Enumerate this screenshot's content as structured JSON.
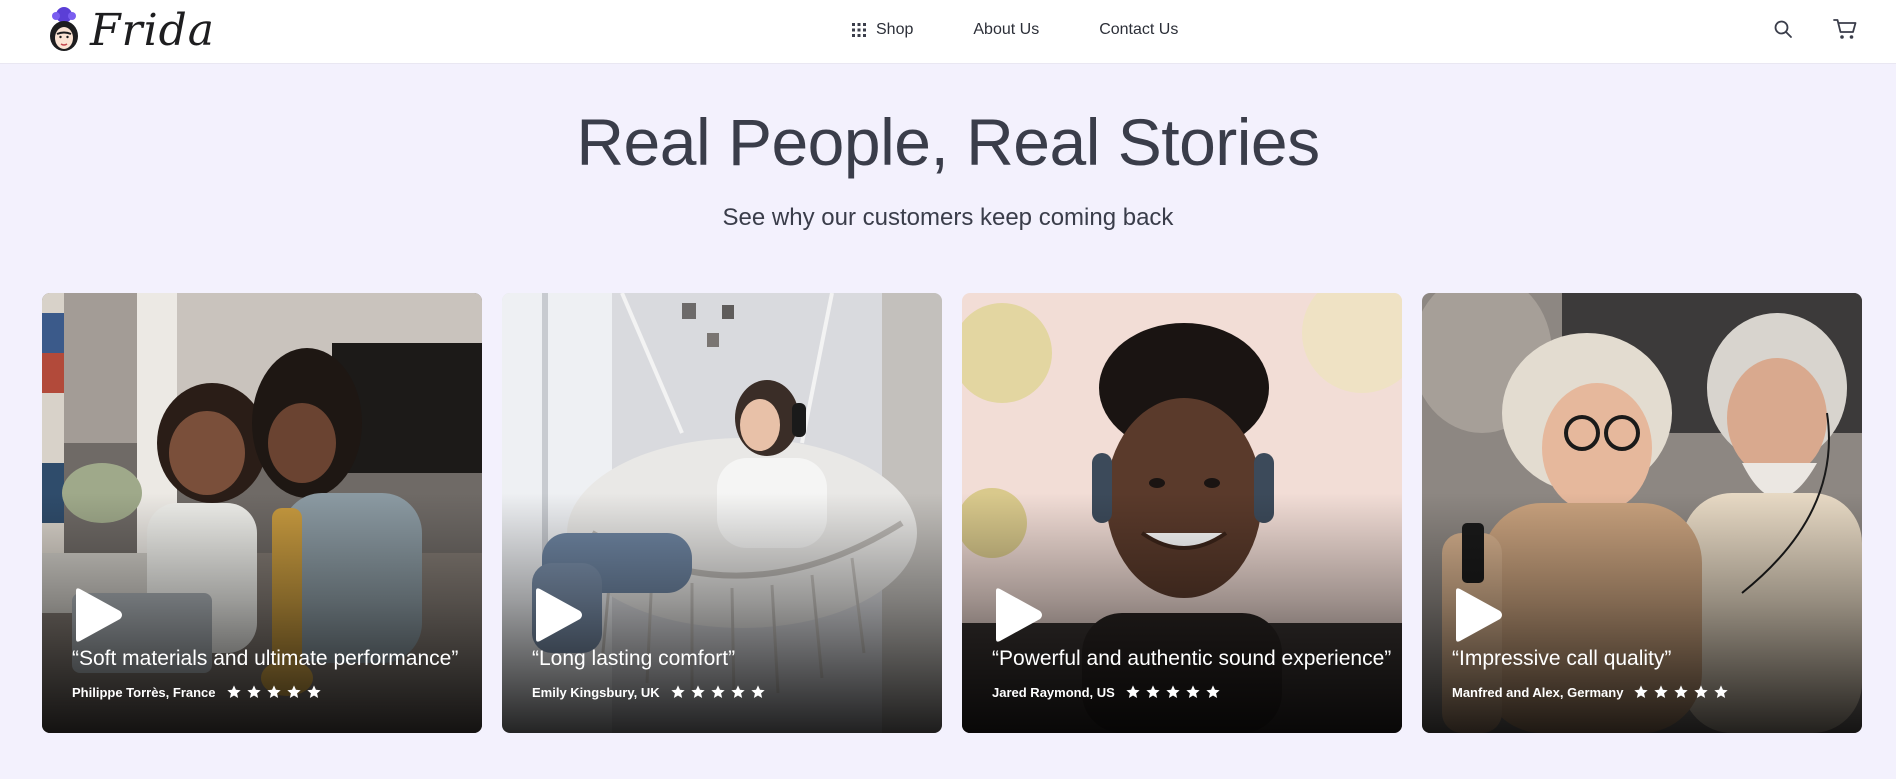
{
  "header": {
    "brand": "Frida",
    "nav": [
      {
        "label": "Shop",
        "icon": "grid-icon"
      },
      {
        "label": "About Us"
      },
      {
        "label": "Contact Us"
      }
    ],
    "icons": [
      "search-icon",
      "cart-icon"
    ]
  },
  "hero": {
    "title": "Real People, Real Stories",
    "subtitle": "See why our customers keep coming back"
  },
  "testimonials": [
    {
      "quote": "“Soft materials and ultimate performance”",
      "reviewer": "Philippe Torrès, France",
      "rating": 5
    },
    {
      "quote": "“Long lasting comfort”",
      "reviewer": "Emily Kingsbury, UK",
      "rating": 5
    },
    {
      "quote": "“Powerful and authentic sound experience”",
      "reviewer": "Jared Raymond, US",
      "rating": 5
    },
    {
      "quote": "“Impressive call quality”",
      "reviewer": "Manfred and Alex, Germany",
      "rating": 5
    }
  ],
  "colors": {
    "page_background": "#f3f1fd",
    "header_background": "#ffffff",
    "text": "#3a3d4a",
    "logo_accent": "#5b3fd6",
    "star": "#ffffff"
  }
}
